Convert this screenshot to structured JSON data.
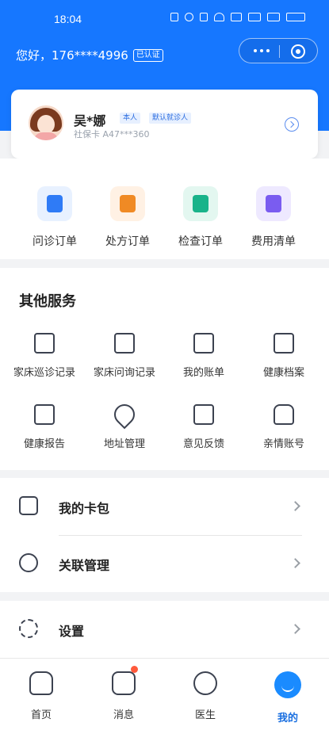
{
  "status_bar": {
    "time": "18:04"
  },
  "header": {
    "greeting": "您好，176****4996",
    "verified_badge": "已认证"
  },
  "profile": {
    "name": "吴*娜",
    "tag_self": "本人",
    "tag_default": "默认就诊人",
    "card": "社保卡 A47***360"
  },
  "orders": [
    {
      "label": "问诊订单",
      "icon": "chat-icon",
      "color": "#2f7bf6",
      "bg": "#e8f1ff"
    },
    {
      "label": "处方订单",
      "icon": "prescription-icon",
      "color": "#f08a24",
      "bg": "#fff1e4"
    },
    {
      "label": "检查订单",
      "icon": "exam-doc-icon",
      "color": "#19b38a",
      "bg": "#e3f7f0"
    },
    {
      "label": "费用清单",
      "icon": "fee-list-icon",
      "color": "#7a5cf0",
      "bg": "#eee9ff"
    }
  ],
  "other_services": {
    "title": "其他服务",
    "items": [
      {
        "label": "家床巡诊记录",
        "icon": "inspection-record-icon"
      },
      {
        "label": "家床问询记录",
        "icon": "inquiry-record-icon"
      },
      {
        "label": "我的账单",
        "icon": "bill-icon"
      },
      {
        "label": "健康档案",
        "icon": "health-file-icon"
      },
      {
        "label": "健康报告",
        "icon": "health-report-icon"
      },
      {
        "label": "地址管理",
        "icon": "location-icon"
      },
      {
        "label": "意见反馈",
        "icon": "feedback-icon"
      },
      {
        "label": "亲情账号",
        "icon": "family-account-icon"
      }
    ]
  },
  "list": {
    "wallet": "我的卡包",
    "linked": "关联管理",
    "settings": "设置"
  },
  "tabbar": [
    {
      "label": "首页",
      "icon": "home-icon"
    },
    {
      "label": "消息",
      "icon": "message-icon"
    },
    {
      "label": "医生",
      "icon": "doctor-icon"
    },
    {
      "label": "我的",
      "icon": "me-icon"
    }
  ],
  "colors": {
    "brand": "#1677ff",
    "accent_active": "#1a8bff",
    "badge_dot": "#ff5a3c"
  }
}
